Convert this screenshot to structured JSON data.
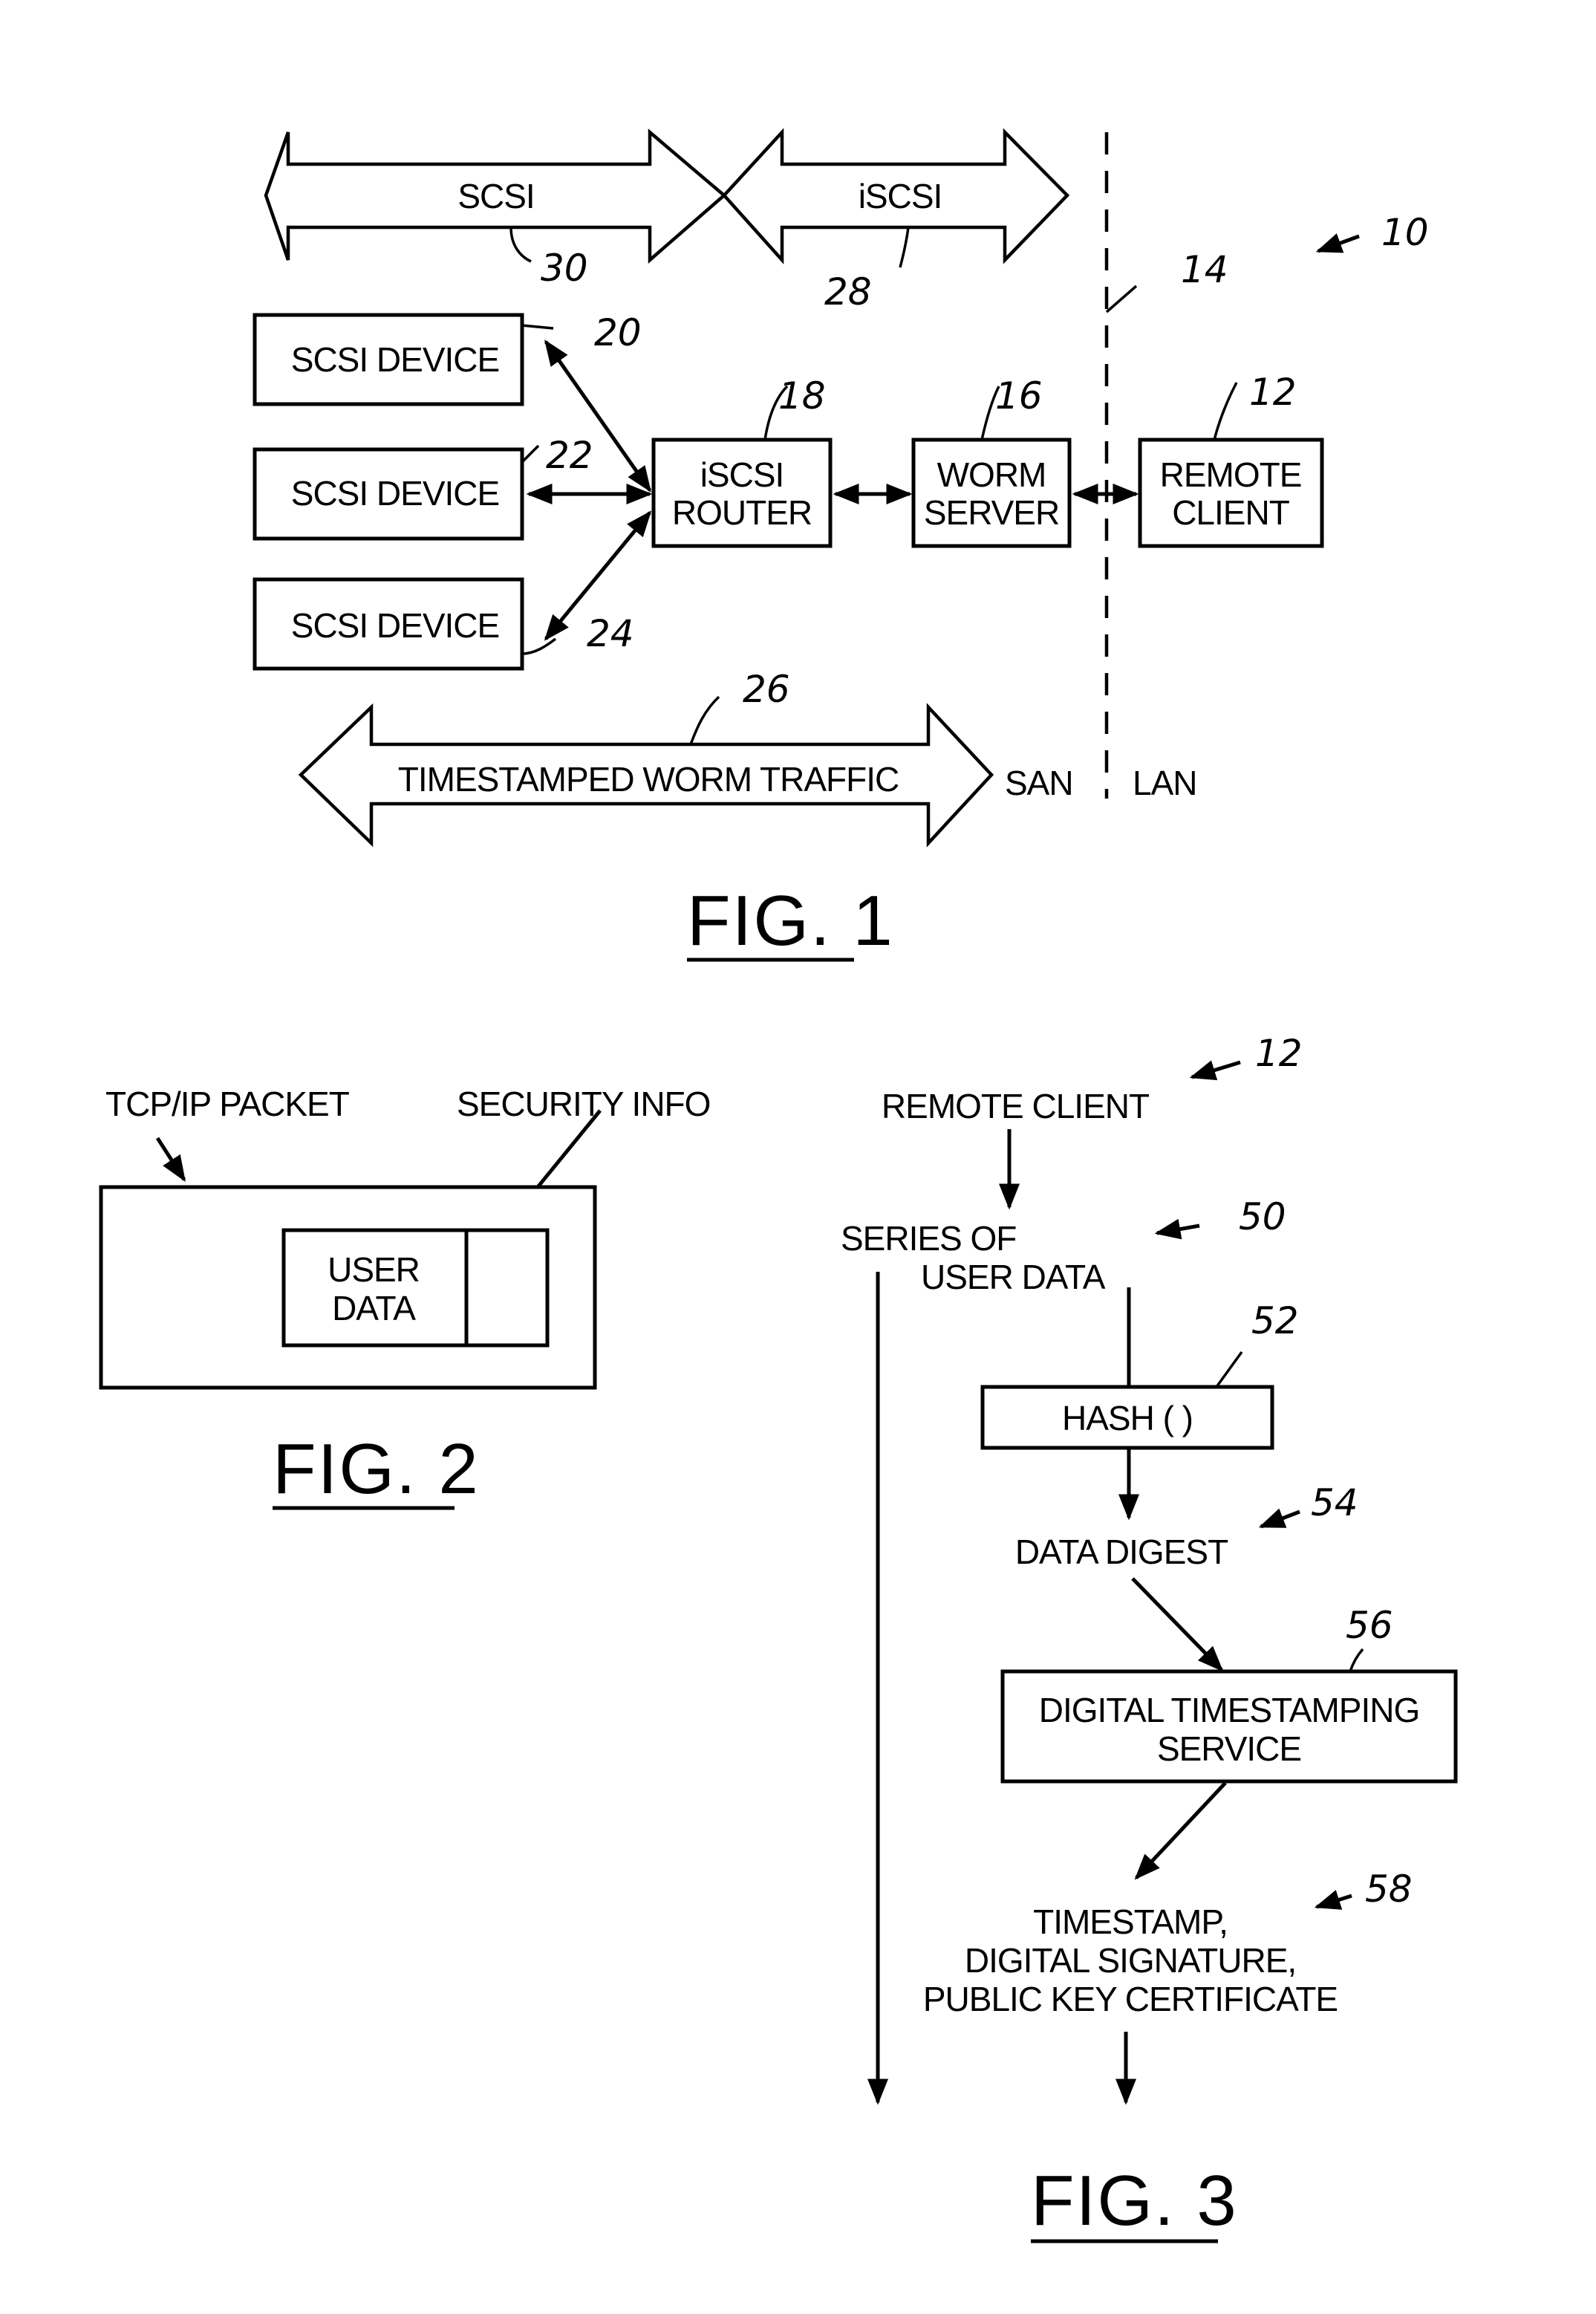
{
  "fig1": {
    "title": "FIG. 1",
    "ref_system": "10",
    "ref_boundary": "14",
    "buses": {
      "scsi": {
        "label": "SCSI",
        "ref": "30"
      },
      "iscsi": {
        "label": "iSCSI",
        "ref": "28"
      },
      "worm_traffic": {
        "label": "TIMESTAMPED WORM TRAFFIC",
        "ref": "26"
      }
    },
    "devices": [
      {
        "label": "SCSI DEVICE",
        "ref": "20"
      },
      {
        "label": "SCSI DEVICE",
        "ref": "22"
      },
      {
        "label": "SCSI DEVICE",
        "ref": "24"
      }
    ],
    "router": {
      "line1": "iSCSI",
      "line2": "ROUTER",
      "ref": "18"
    },
    "worm_server": {
      "line1": "WORM",
      "line2": "SERVER",
      "ref": "16"
    },
    "remote_client": {
      "line1": "REMOTE",
      "line2": "CLIENT",
      "ref": "12"
    },
    "zones": {
      "left": "SAN",
      "right": "LAN"
    }
  },
  "fig2": {
    "title": "FIG. 2",
    "packet_label": "TCP/IP PACKET",
    "security_label": "SECURITY INFO",
    "user_data_line1": "USER",
    "user_data_line2": "DATA"
  },
  "fig3": {
    "title": "FIG. 3",
    "remote_client": {
      "label": "REMOTE CLIENT",
      "ref": "12"
    },
    "series": {
      "line1": "SERIES OF",
      "line2": "USER DATA",
      "ref": "50"
    },
    "hash": {
      "label": "HASH ( )",
      "ref": "52"
    },
    "digest": {
      "label": "DATA DIGEST",
      "ref": "54"
    },
    "timestamping": {
      "line1": "DIGITAL TIMESTAMPING",
      "line2": "SERVICE",
      "ref": "56"
    },
    "output": {
      "line1": "TIMESTAMP,",
      "line2": "DIGITAL SIGNATURE,",
      "line3": "PUBLIC KEY CERTIFICATE",
      "ref": "58"
    }
  }
}
